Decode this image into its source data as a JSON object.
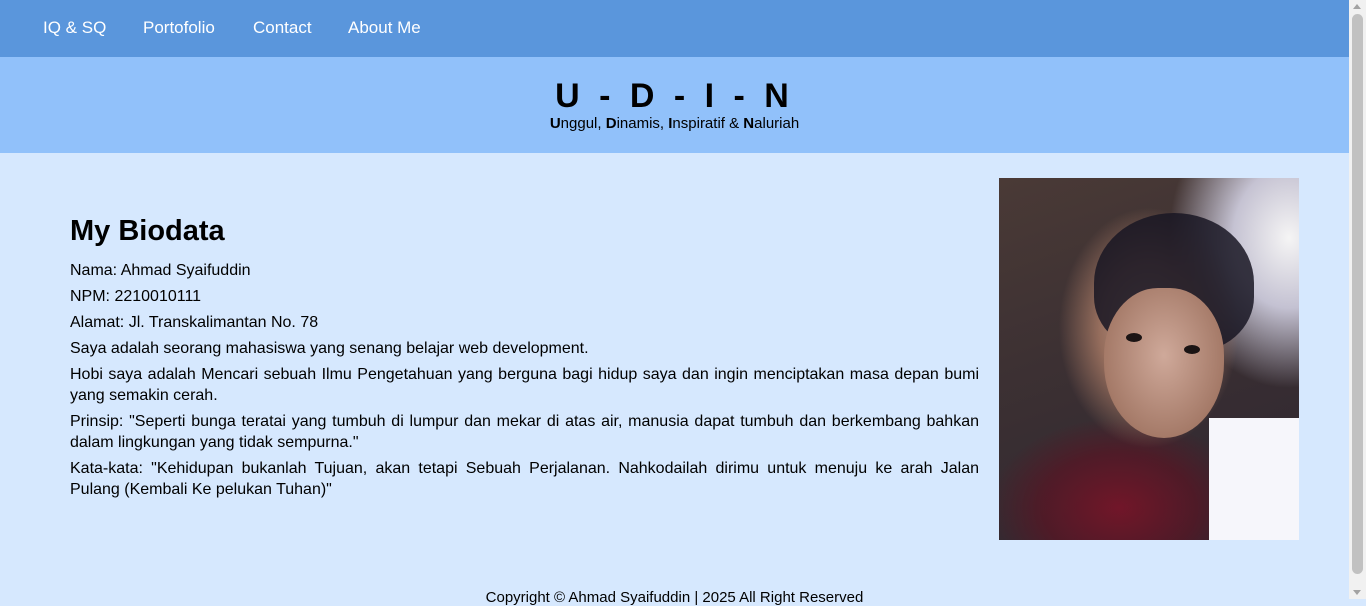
{
  "nav": {
    "items": [
      {
        "label": "IQ & SQ"
      },
      {
        "label": "Portofolio"
      },
      {
        "label": "Contact"
      },
      {
        "label": "About Me"
      }
    ]
  },
  "header": {
    "title": "U - D - I - N",
    "tagline": {
      "w1_initial": "U",
      "w1_rest": "nggul, ",
      "w2_initial": "D",
      "w2_rest": "inamis, ",
      "w3_initial": "I",
      "w3_rest": "nspiratif & ",
      "w4_initial": "N",
      "w4_rest": "aluriah"
    }
  },
  "biodata": {
    "heading": "My Biodata",
    "name": "Nama: Ahmad Syaifuddin",
    "npm": "NPM: 2210010111",
    "address": "Alamat: Jl. Transkalimantan No. 78",
    "intro": "Saya adalah seorang mahasiswa yang senang belajar web development.",
    "hobby": "Hobi saya adalah Mencari sebuah Ilmu Pengetahuan yang berguna bagi hidup saya dan ingin menciptakan masa depan bumi yang semakin cerah.",
    "principle": "Prinsip: \"Seperti bunga teratai yang tumbuh di lumpur dan mekar di atas air, manusia dapat tumbuh dan berkembang bahkan dalam lingkungan yang tidak sempurna.\"",
    "quote": "Kata-kata: \"Kehidupan bukanlah Tujuan, akan tetapi Sebuah Perjalanan. Nahkodailah dirimu untuk menuju ke arah Jalan Pulang (Kembali Ke pelukan Tuhan)\""
  },
  "footer": {
    "copyright": "Copyright © Ahmad Syaifuddin | 2025 All Right Reserved"
  },
  "colors": {
    "navbar": "#5a96dc",
    "header": "#91c1fa",
    "page_background": "#d6e8fe"
  }
}
